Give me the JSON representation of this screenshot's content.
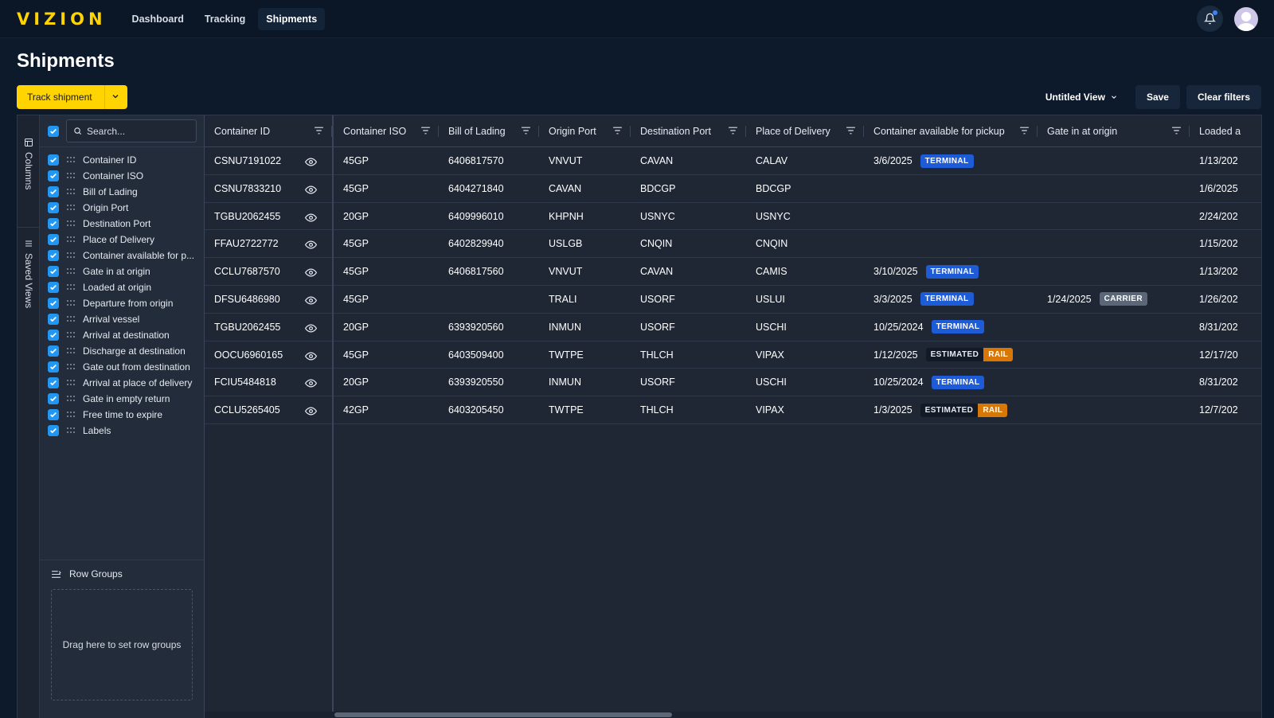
{
  "app": {
    "logo": "VIZION"
  },
  "nav": [
    {
      "label": "Dashboard",
      "active": false
    },
    {
      "label": "Tracking",
      "active": false
    },
    {
      "label": "Shipments",
      "active": true
    }
  ],
  "page": {
    "title": "Shipments"
  },
  "actions": {
    "track_label": "Track shipment",
    "view_label": "Untitled View",
    "save_label": "Save",
    "clear_label": "Clear filters"
  },
  "side_tabs": {
    "columns": "Columns",
    "saved_views": "Saved Views"
  },
  "columns_panel": {
    "search_placeholder": "Search...",
    "items": [
      "Container ID",
      "Container ISO",
      "Bill of Lading",
      "Origin Port",
      "Destination Port",
      "Place of Delivery",
      "Container available for p...",
      "Gate in at origin",
      "Loaded at origin",
      "Departure from origin",
      "Arrival vessel",
      "Arrival at destination",
      "Discharge at destination",
      "Gate out from destination",
      "Arrival at place of delivery",
      "Gate in empty return",
      "Free time to expire",
      "Labels"
    ]
  },
  "row_groups": {
    "title": "Row Groups",
    "drop_hint": "Drag here to set row groups"
  },
  "table": {
    "headers": [
      "Container ID",
      "Container ISO",
      "Bill of Lading",
      "Origin Port",
      "Destination Port",
      "Place of Delivery",
      "Container available for pickup",
      "Gate in at origin",
      "Loaded a"
    ],
    "rows": [
      {
        "id": "CSNU7191022",
        "iso": "45GP",
        "bol": "6406817570",
        "origin": "VNVUT",
        "dest": "CAVAN",
        "pod": "CALAV",
        "avail": "3/6/2025",
        "avail_badges": [
          "TERMINAL"
        ],
        "gate_in": "",
        "gate_badges": [],
        "loaded": "1/13/202"
      },
      {
        "id": "CSNU7833210",
        "iso": "45GP",
        "bol": "6404271840",
        "origin": "CAVAN",
        "dest": "BDCGP",
        "pod": "BDCGP",
        "avail": "",
        "avail_badges": [],
        "gate_in": "",
        "gate_badges": [],
        "loaded": "1/6/2025"
      },
      {
        "id": "TGBU2062455",
        "iso": "20GP",
        "bol": "6409996010",
        "origin": "KHPNH",
        "dest": "USNYC",
        "pod": "USNYC",
        "avail": "",
        "avail_badges": [],
        "gate_in": "",
        "gate_badges": [],
        "loaded": "2/24/202"
      },
      {
        "id": "FFAU2722772",
        "iso": "45GP",
        "bol": "6402829940",
        "origin": "USLGB",
        "dest": "CNQIN",
        "pod": "CNQIN",
        "avail": "",
        "avail_badges": [],
        "gate_in": "",
        "gate_badges": [],
        "loaded": "1/15/202"
      },
      {
        "id": "CCLU7687570",
        "iso": "45GP",
        "bol": "6406817560",
        "origin": "VNVUT",
        "dest": "CAVAN",
        "pod": "CAMIS",
        "avail": "3/10/2025",
        "avail_badges": [
          "TERMINAL"
        ],
        "gate_in": "",
        "gate_badges": [],
        "loaded": "1/13/202"
      },
      {
        "id": "DFSU6486980",
        "iso": "45GP",
        "bol": "",
        "origin": "TRALI",
        "dest": "USORF",
        "pod": "USLUI",
        "avail": "3/3/2025",
        "avail_badges": [
          "TERMINAL"
        ],
        "gate_in": "1/24/2025",
        "gate_badges": [
          "CARRIER"
        ],
        "loaded": "1/26/202"
      },
      {
        "id": "TGBU2062455",
        "iso": "20GP",
        "bol": "6393920560",
        "origin": "INMUN",
        "dest": "USORF",
        "pod": "USCHI",
        "avail": "10/25/2024",
        "avail_badges": [
          "TERMINAL"
        ],
        "gate_in": "",
        "gate_badges": [],
        "loaded": "8/31/202"
      },
      {
        "id": "OOCU6960165",
        "iso": "45GP",
        "bol": "6403509400",
        "origin": "TWTPE",
        "dest": "THLCH",
        "pod": "VIPAX",
        "avail": "1/12/2025",
        "avail_badges": [
          "ESTIMATED",
          "RAIL"
        ],
        "gate_in": "",
        "gate_badges": [],
        "loaded": "12/17/20"
      },
      {
        "id": "FCIU5484818",
        "iso": "20GP",
        "bol": "6393920550",
        "origin": "INMUN",
        "dest": "USORF",
        "pod": "USCHI",
        "avail": "10/25/2024",
        "avail_badges": [
          "TERMINAL"
        ],
        "gate_in": "",
        "gate_badges": [],
        "loaded": "8/31/202"
      },
      {
        "id": "CCLU5265405",
        "iso": "42GP",
        "bol": "6403205450",
        "origin": "TWTPE",
        "dest": "THLCH",
        "pod": "VIPAX",
        "avail": "1/3/2025",
        "avail_badges": [
          "ESTIMATED",
          "RAIL"
        ],
        "gate_in": "",
        "gate_badges": [],
        "loaded": "12/7/202"
      }
    ]
  },
  "colors": {
    "brand": "#ffd400",
    "terminal": "#1e5bd6",
    "carrier": "#5b6676",
    "rail": "#d97706",
    "checkbox": "#2196f3"
  },
  "icons": [
    "bell-icon",
    "avatar-icon",
    "chevron-down-icon",
    "search-icon",
    "grip-icon",
    "filter-icon",
    "eye-icon",
    "columns-icon",
    "saved-views-icon",
    "row-groups-icon",
    "check-icon"
  ]
}
